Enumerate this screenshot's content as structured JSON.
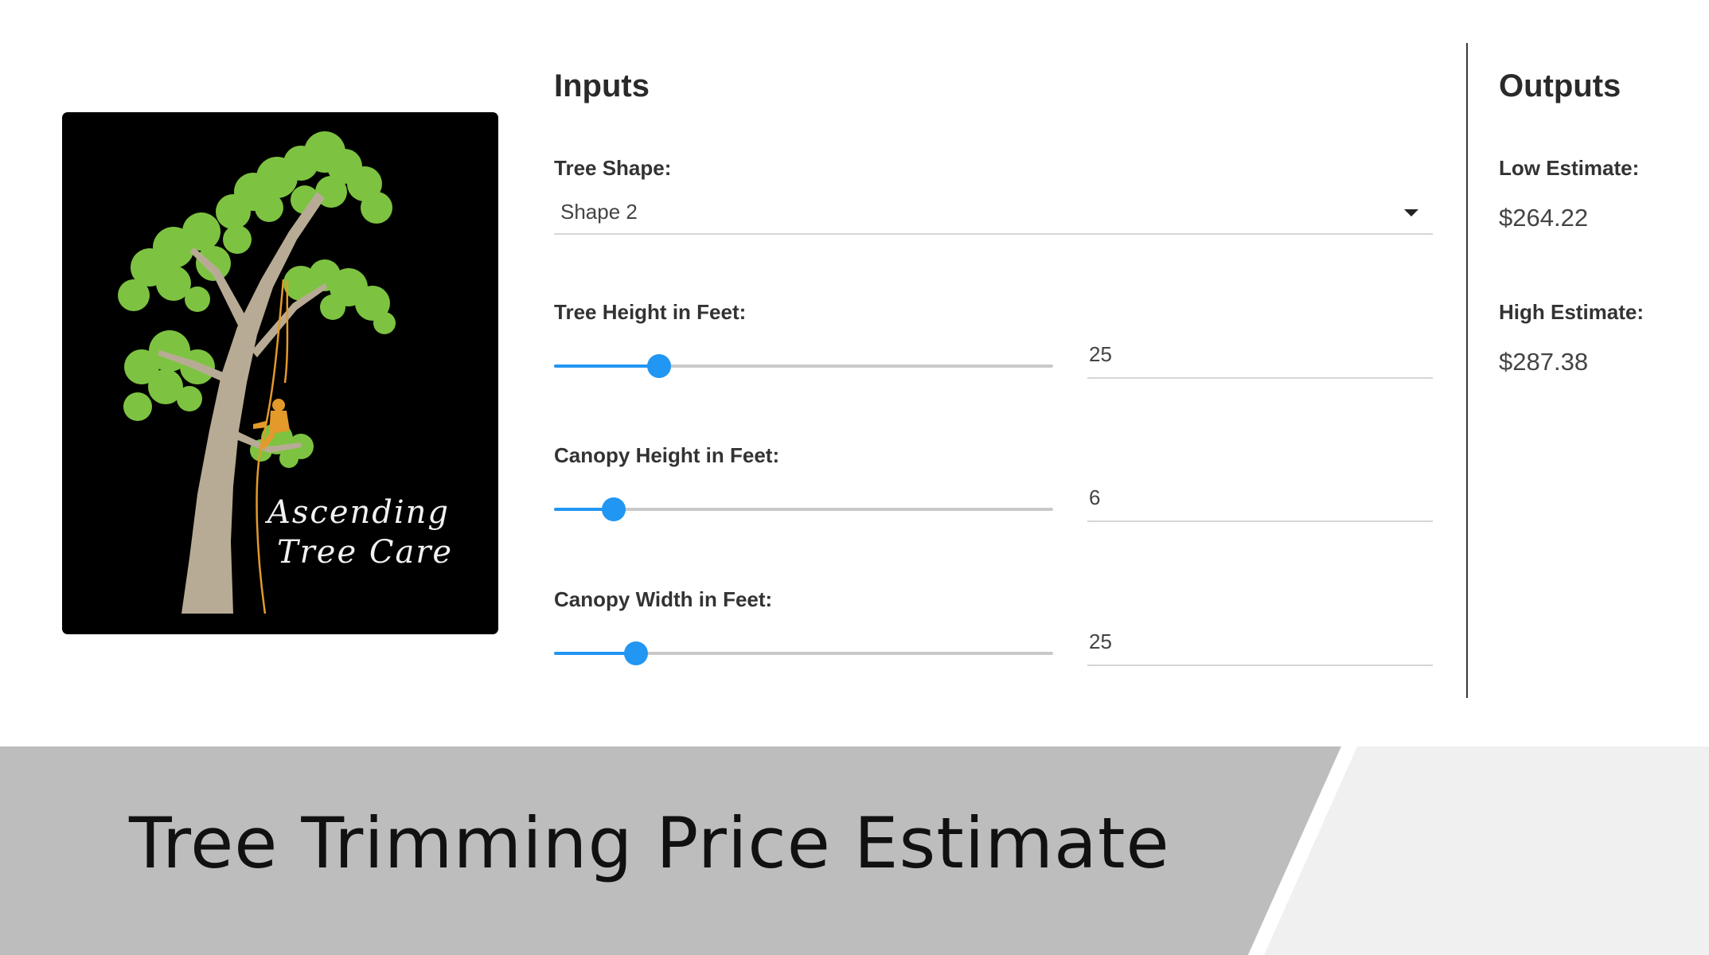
{
  "logo": {
    "line1": "Ascending",
    "line2": "Tree Care",
    "colors": {
      "background": "#000000",
      "foliage": "#7dc341",
      "trunk": "#b8ab95",
      "rope": "#e39a2a"
    }
  },
  "inputs": {
    "title": "Inputs",
    "tree_shape": {
      "label": "Tree Shape:",
      "value": "Shape 2"
    },
    "tree_height": {
      "label": "Tree Height in Feet:",
      "value": "25",
      "slider_fraction": 0.21
    },
    "canopy_height": {
      "label": "Canopy Height in Feet:",
      "value": "6",
      "slider_fraction": 0.12
    },
    "canopy_width": {
      "label": "Canopy Width in Feet:",
      "value": "25",
      "slider_fraction": 0.165
    }
  },
  "outputs": {
    "title": "Outputs",
    "low": {
      "label": "Low Estimate:",
      "value": "$264.22"
    },
    "high": {
      "label": "High Estimate:",
      "value": "$287.38"
    }
  },
  "banner": {
    "title": "Tree Trimming Price Estimate"
  },
  "colors": {
    "accent": "#2196f3",
    "banner_dark": "#bdbdbd",
    "banner_light": "#f0f0f0"
  }
}
